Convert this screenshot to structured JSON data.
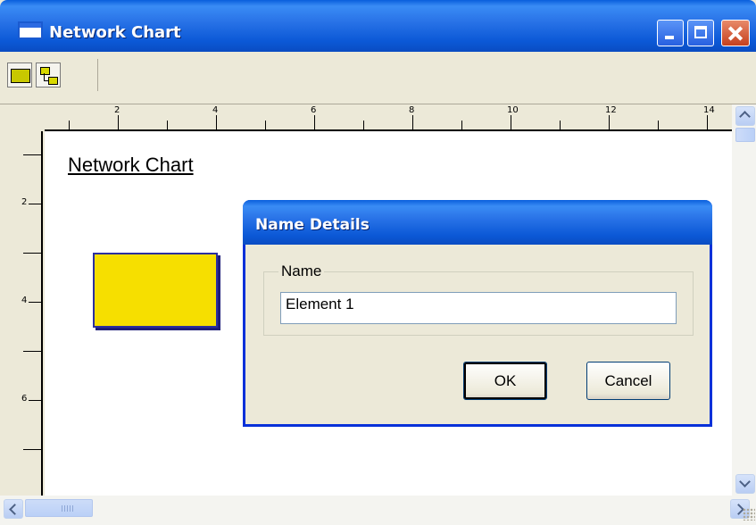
{
  "window": {
    "title": "Network Chart"
  },
  "toolbar": {
    "tools": [
      {
        "name": "rectangle-tool",
        "icon": "yellow-rectangle-icon"
      },
      {
        "name": "connector-tool",
        "icon": "linked-boxes-icon"
      }
    ]
  },
  "ruler": {
    "horizontal_labels": [
      "2",
      "4",
      "6",
      "8",
      "10",
      "12",
      "14"
    ],
    "vertical_labels": [
      "2",
      "4",
      "6"
    ]
  },
  "canvas": {
    "document_title": "Network Chart",
    "shape_fill_color": "#f6df00",
    "shape_border_color": "#2b2fa0"
  },
  "dialog": {
    "title": "Name Details",
    "group_label": "Name",
    "name_value": "Element 1",
    "ok_label": "OK",
    "cancel_label": "Cancel"
  },
  "colors": {
    "titlebar_blue": "#0b58d6",
    "close_button": "#c5401e",
    "window_face": "#ece9d8"
  }
}
